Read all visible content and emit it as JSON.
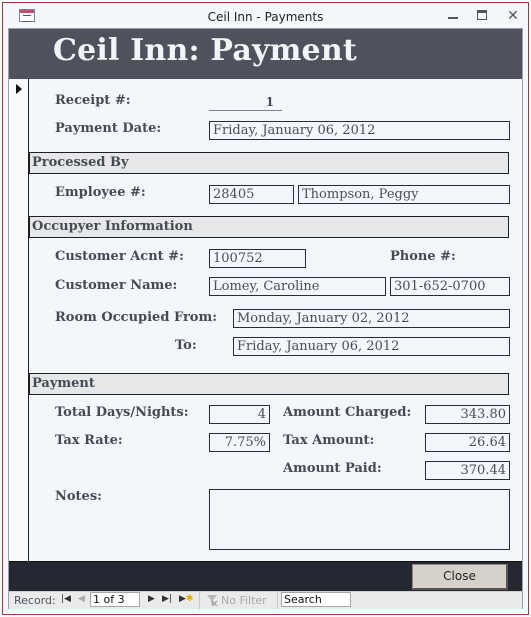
{
  "window": {
    "title": "Ceil Inn - Payments",
    "controls": {
      "minimize": "minimize",
      "maximize": "maximize",
      "close": "close"
    }
  },
  "form": {
    "header_title": "Ceil Inn: Payment",
    "receipt": {
      "label": "Receipt #:",
      "value": "1"
    },
    "payment_date": {
      "label": "Payment Date:",
      "value": "Friday, January 06, 2012"
    },
    "sections": {
      "processed_by": "Processed By",
      "occupyer_information": "Occupyer Information",
      "payment": "Payment"
    },
    "employee": {
      "label": "Employee #:",
      "number": "28405",
      "name": "Thompson, Peggy"
    },
    "customer_acnt": {
      "label": "Customer Acnt #:",
      "value": "100752"
    },
    "phone": {
      "label": "Phone #:",
      "value": "301-652-0700"
    },
    "customer_name": {
      "label": "Customer Name:",
      "value": "Lomey, Caroline"
    },
    "room_from": {
      "label": "Room Occupied From:",
      "value": "Monday, January 02, 2012"
    },
    "room_to": {
      "label": "To:",
      "value": "Friday, January 06, 2012"
    },
    "total_days": {
      "label": "Total Days/Nights:",
      "value": "4"
    },
    "amount_charged": {
      "label": "Amount Charged:",
      "value": "343.80"
    },
    "tax_rate": {
      "label": "Tax Rate:",
      "value": "7.75%"
    },
    "tax_amount": {
      "label": "Tax Amount:",
      "value": "26.64"
    },
    "amount_paid": {
      "label": "Amount Paid:",
      "value": "370.44"
    },
    "notes": {
      "label": "Notes:",
      "value": ""
    },
    "close_button": "Close"
  },
  "navigation": {
    "record_label": "Record:",
    "current": "1 of 3",
    "filter_label": "No Filter",
    "search_label": "Search",
    "icons": {
      "first": "first-record-icon",
      "previous": "previous-record-icon",
      "next": "next-record-icon",
      "last": "last-record-icon",
      "new": "new-record-icon",
      "filter": "no-filter-icon"
    }
  },
  "colors": {
    "header_bg": "#4e525c",
    "footer_bg": "#252833",
    "section_bg": "#e6e7e9",
    "label_text": "#474a55",
    "window_border": "#a33b3b"
  }
}
